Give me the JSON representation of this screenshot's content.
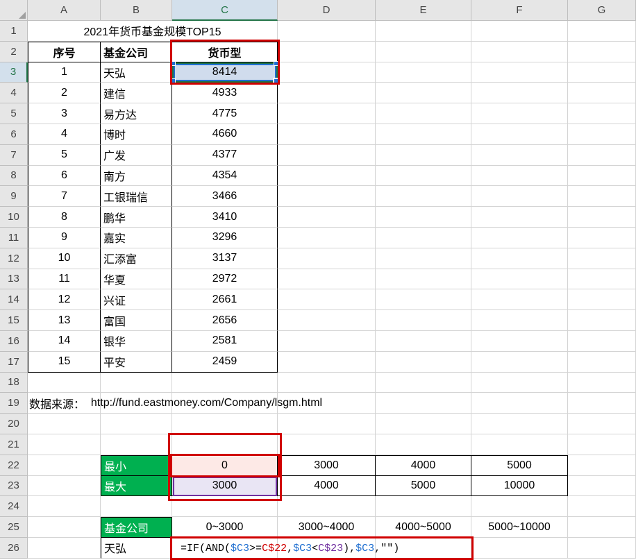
{
  "columns": [
    "A",
    "B",
    "C",
    "D",
    "E",
    "F",
    "G"
  ],
  "col_widths": {
    "A": 105,
    "B": 103,
    "C": 152,
    "D": 141,
    "E": 138,
    "F": 139,
    "G": 98
  },
  "row_count": 26,
  "active_col": "C",
  "active_rows": [
    3
  ],
  "title_cell": {
    "row": 1,
    "colspan": 3,
    "text": "2021年货币基金规模TOP15"
  },
  "headers": {
    "row": 2,
    "A": "序号",
    "B": "基金公司",
    "C": "货币型"
  },
  "data_rows": [
    {
      "row": 3,
      "A": "1",
      "B": "天弘",
      "C": "8414"
    },
    {
      "row": 4,
      "A": "2",
      "B": "建信",
      "C": "4933"
    },
    {
      "row": 5,
      "A": "3",
      "B": "易方达",
      "C": "4775"
    },
    {
      "row": 6,
      "A": "4",
      "B": "博时",
      "C": "4660"
    },
    {
      "row": 7,
      "A": "5",
      "B": "广发",
      "C": "4377"
    },
    {
      "row": 8,
      "A": "6",
      "B": "南方",
      "C": "4354"
    },
    {
      "row": 9,
      "A": "7",
      "B": "工银瑞信",
      "C": "3466"
    },
    {
      "row": 10,
      "A": "8",
      "B": "鹏华",
      "C": "3410"
    },
    {
      "row": 11,
      "A": "9",
      "B": "嘉实",
      "C": "3296"
    },
    {
      "row": 12,
      "A": "10",
      "B": "汇添富",
      "C": "3137"
    },
    {
      "row": 13,
      "A": "11",
      "B": "华夏",
      "C": "2972"
    },
    {
      "row": 14,
      "A": "12",
      "B": "兴证",
      "C": "2661"
    },
    {
      "row": 15,
      "A": "13",
      "B": "富国",
      "C": "2656"
    },
    {
      "row": 16,
      "A": "14",
      "B": "银华",
      "C": "2581"
    },
    {
      "row": 17,
      "A": "15",
      "B": "平安",
      "C": "2459"
    }
  ],
  "source": {
    "row": 19,
    "label": "数据来源：",
    "url": "http://fund.eastmoney.com/Company/lsgm.html"
  },
  "bounds": {
    "row_min": {
      "row": 22,
      "label": "最小",
      "C": "0",
      "D": "3000",
      "E": "4000",
      "F": "5000"
    },
    "row_max": {
      "row": 23,
      "label": "最大",
      "C": "3000",
      "D": "4000",
      "E": "5000",
      "F": "10000"
    }
  },
  "summary_header": {
    "row": 25,
    "B": "基金公司",
    "C": "0~3000",
    "D": "3000~4000",
    "E": "4000~5000",
    "F": "5000~10000"
  },
  "summary_row": {
    "row": 26,
    "B": "天弘"
  },
  "formula": {
    "cell": "C26",
    "parts": [
      {
        "t": "=IF(",
        "c": "f-black"
      },
      {
        "t": "AND(",
        "c": "f-black"
      },
      {
        "t": "$C3",
        "c": "f-blue"
      },
      {
        "t": ">=",
        "c": "f-black"
      },
      {
        "t": "C$22",
        "c": "f-red"
      },
      {
        "t": ",",
        "c": "f-black"
      },
      {
        "t": "$C3",
        "c": "f-blue"
      },
      {
        "t": "<",
        "c": "f-black"
      },
      {
        "t": "C$23",
        "c": "f-purple"
      },
      {
        "t": ")",
        "c": "f-black"
      },
      {
        "t": ",",
        "c": "f-black"
      },
      {
        "t": "$C3",
        "c": "f-blue"
      },
      {
        "t": ",\"\")",
        "c": "f-black"
      }
    ]
  },
  "chart_data": {
    "type": "table",
    "title": "2021年货币基金规模TOP15",
    "columns": [
      "序号",
      "基金公司",
      "货币型"
    ],
    "rows": [
      [
        1,
        "天弘",
        8414
      ],
      [
        2,
        "建信",
        4933
      ],
      [
        3,
        "易方达",
        4775
      ],
      [
        4,
        "博时",
        4660
      ],
      [
        5,
        "广发",
        4377
      ],
      [
        6,
        "南方",
        4354
      ],
      [
        7,
        "工银瑞信",
        3466
      ],
      [
        8,
        "鹏华",
        3410
      ],
      [
        9,
        "嘉实",
        3296
      ],
      [
        10,
        "汇添富",
        3137
      ],
      [
        11,
        "华夏",
        2972
      ],
      [
        12,
        "兴证",
        2661
      ],
      [
        13,
        "富国",
        2656
      ],
      [
        14,
        "银华",
        2581
      ],
      [
        15,
        "平安",
        2459
      ]
    ]
  }
}
